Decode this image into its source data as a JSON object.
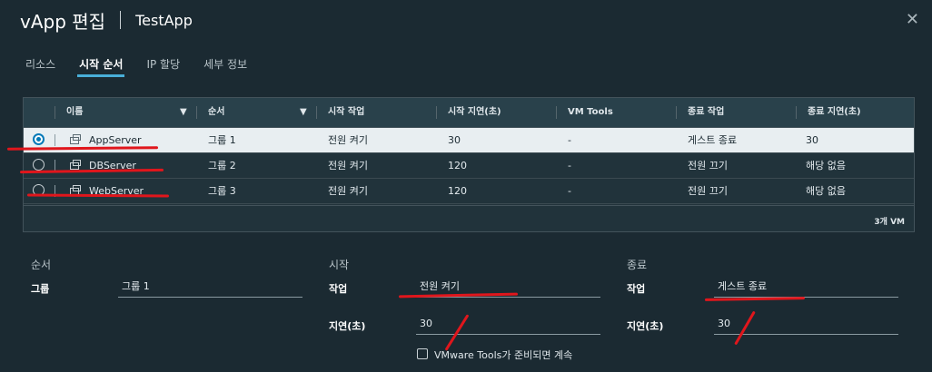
{
  "dialog": {
    "title": "vApp 편집",
    "subtitle": "TestApp"
  },
  "tabs": [
    "리소스",
    "시작 순서",
    "IP 할당",
    "세부 정보"
  ],
  "active_tab": "시작 순서",
  "columns": [
    "이름",
    "순서",
    "시작 작업",
    "시작 지연(초)",
    "VM Tools",
    "종료 작업",
    "종료 지연(초)"
  ],
  "rows": [
    {
      "name": "AppServer",
      "order": "그룹 1",
      "start_action": "전원 켜기",
      "start_delay": "30",
      "vm_tools": "-",
      "stop_action": "게스트 종료",
      "stop_delay": "30",
      "selected": true
    },
    {
      "name": "DBServer",
      "order": "그룹 2",
      "start_action": "전원 켜기",
      "start_delay": "120",
      "vm_tools": "-",
      "stop_action": "전원 끄기",
      "stop_delay": "해당 없음",
      "selected": false
    },
    {
      "name": "WebServer",
      "order": "그룹 3",
      "start_action": "전원 켜기",
      "start_delay": "120",
      "vm_tools": "-",
      "stop_action": "전원 끄기",
      "stop_delay": "해당 없음",
      "selected": false
    }
  ],
  "footer": {
    "count": "3개 VM"
  },
  "order_section": {
    "title": "순서",
    "group_label": "그룹",
    "group_value": "그룹 1"
  },
  "start_section": {
    "title": "시작",
    "action_label": "작업",
    "action_value": "전원 켜기",
    "delay_label": "지연(초)",
    "delay_value": "30",
    "checkbox_label": "VMware Tools가 준비되면 계속",
    "checkbox_checked": false
  },
  "stop_section": {
    "title": "종료",
    "action_label": "작업",
    "action_value": "게스트 종료",
    "delay_label": "지연(초)",
    "delay_value": "30"
  },
  "colors": {
    "accent": "#49afd9",
    "selected_row": "#e8eef1",
    "annotation": "#e0161c"
  }
}
